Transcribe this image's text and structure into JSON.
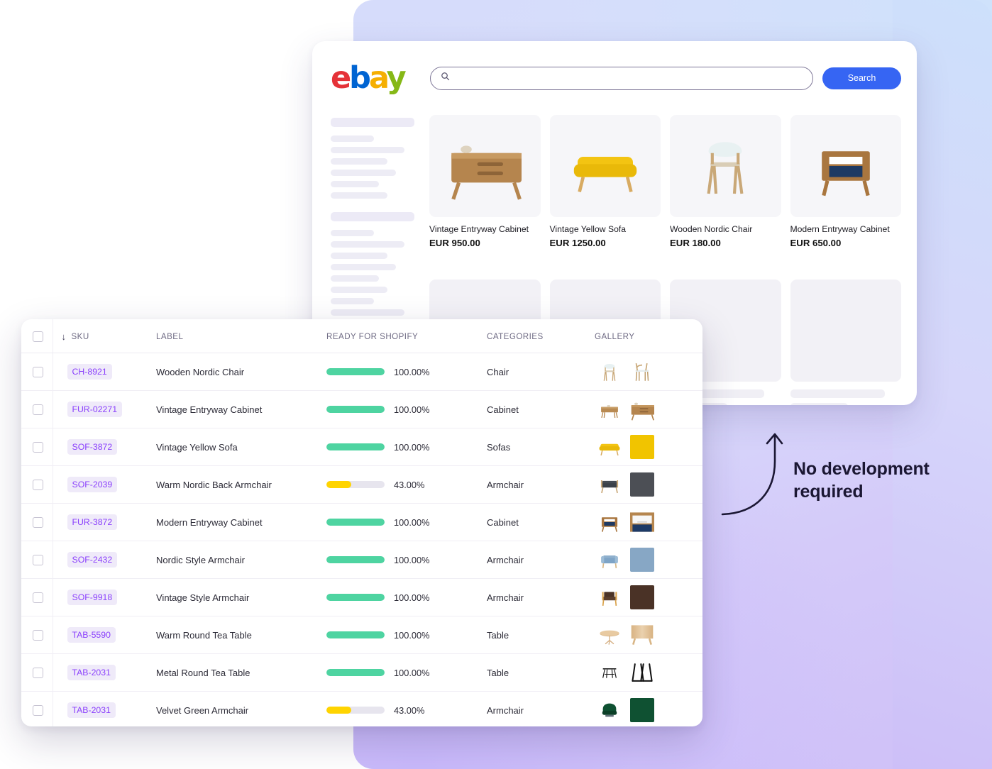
{
  "callout": {
    "line1": "No development",
    "line2": "required",
    "arrow_icon": "curved-arrow-up-icon"
  },
  "ebay": {
    "logo": {
      "letters": [
        "e",
        "b",
        "a",
        "y"
      ],
      "colors": [
        "#e53238",
        "#0064d2",
        "#f5af02",
        "#86b817"
      ]
    },
    "search": {
      "value": "",
      "placeholder": "",
      "icon": "search-icon",
      "button_label": "Search"
    },
    "products": [
      {
        "title": "Vintage Entryway Cabinet",
        "price": "EUR 950.00",
        "image": "vintage-entryway-cabinet"
      },
      {
        "title": "Vintage Yellow Sofa",
        "price": "EUR 1250.00",
        "image": "vintage-yellow-sofa"
      },
      {
        "title": "Wooden Nordic Chair",
        "price": "EUR 180.00",
        "image": "wooden-nordic-chair"
      },
      {
        "title": "Modern Entryway Cabinet",
        "price": "EUR 650.00",
        "image": "modern-entryway-cabinet"
      }
    ],
    "skeleton_cards": 4,
    "sidebar_skeleton_groups": [
      [
        100,
        52,
        88,
        68,
        78,
        58,
        68
      ],
      [
        100,
        52,
        88,
        68,
        78,
        58,
        68,
        52,
        88,
        68,
        78,
        58,
        68
      ],
      [
        100,
        52,
        88,
        68
      ]
    ]
  },
  "table": {
    "columns": [
      {
        "key": "check",
        "label": ""
      },
      {
        "key": "sku",
        "label": "SKU",
        "sort_icon": "sort-descending-arrow-icon"
      },
      {
        "key": "label",
        "label": "LABEL"
      },
      {
        "key": "ready",
        "label": "READY FOR SHOPIFY"
      },
      {
        "key": "categories",
        "label": "CATEGORIES"
      },
      {
        "key": "gallery",
        "label": "GALLERY"
      }
    ],
    "bar_colors": {
      "complete": "#4ed4a1",
      "partial": "#ffd400",
      "track": "#e7e5ee"
    },
    "sku_badge_color": "#8a3ffc",
    "rows": [
      {
        "sku": "CH-8921",
        "label": "Wooden Nordic Chair",
        "ready": "100.00%",
        "percent": 100,
        "category": "Chair",
        "thumbs": [
          "chair-white",
          "chair-wood"
        ]
      },
      {
        "sku": "FUR-02271",
        "label": "Vintage Entryway Cabinet",
        "ready": "100.00%",
        "percent": 100,
        "category": "Cabinet",
        "thumbs": [
          "cabinet-small",
          "cabinet-detail"
        ]
      },
      {
        "sku": "SOF-3872",
        "label": "Vintage Yellow Sofa",
        "ready": "100.00%",
        "percent": 100,
        "category": "Sofas",
        "thumbs": [
          "sofa-yellow",
          "fabric-yellow"
        ]
      },
      {
        "sku": "SOF-2039",
        "label": "Warm Nordic Back Armchair",
        "ready": "43.00%",
        "percent": 43,
        "category": "Armchair",
        "thumbs": [
          "armchair-grey",
          "fabric-grey"
        ]
      },
      {
        "sku": "FUR-3872",
        "label": "Modern Entryway Cabinet",
        "ready": "100.00%",
        "percent": 100,
        "category": "Cabinet",
        "thumbs": [
          "cabinet-blue",
          "cabinet-white-detail"
        ]
      },
      {
        "sku": "SOF-2432",
        "label": "Nordic Style Armchair",
        "ready": "100.00%",
        "percent": 100,
        "category": "Armchair",
        "thumbs": [
          "armchair-blue",
          "fabric-blue"
        ]
      },
      {
        "sku": "SOF-9918",
        "label": "Vintage Style Armchair",
        "ready": "100.00%",
        "percent": 100,
        "category": "Armchair",
        "thumbs": [
          "armchair-brown",
          "fabric-brown"
        ]
      },
      {
        "sku": "TAB-5590",
        "label": "Warm Round Tea Table",
        "ready": "100.00%",
        "percent": 100,
        "category": "Table",
        "thumbs": [
          "table-round-wood",
          "wood-panel"
        ]
      },
      {
        "sku": "TAB-2031",
        "label": "Metal Round Tea Table",
        "ready": "100.00%",
        "percent": 100,
        "category": "Table",
        "thumbs": [
          "table-metal",
          "metal-legs"
        ]
      },
      {
        "sku": "TAB-2031",
        "label": "Velvet Green Armchair",
        "ready": "43.00%",
        "percent": 43,
        "category": "Armchair",
        "thumbs": [
          "armchair-green",
          "velvet-green"
        ]
      }
    ]
  }
}
